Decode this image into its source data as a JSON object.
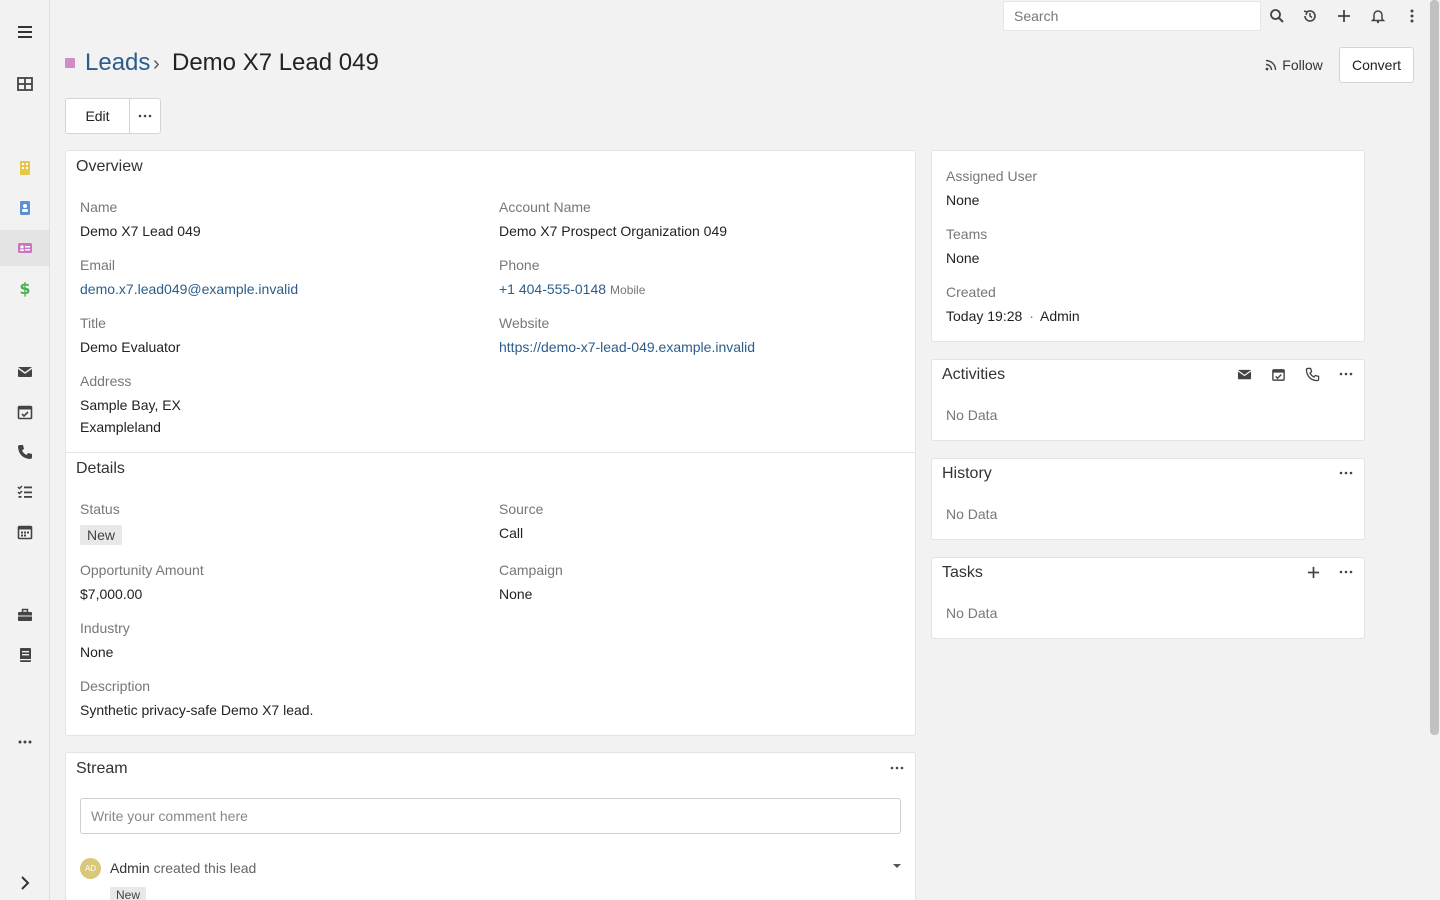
{
  "topbar": {
    "search_placeholder": "Search"
  },
  "header": {
    "scope_link": "Leads",
    "separator": "›",
    "record_name": "Demo X7 Lead 049",
    "follow_label": "Follow",
    "convert_label": "Convert",
    "edit_label": "Edit"
  },
  "overview": {
    "title": "Overview",
    "name_label": "Name",
    "name_value": "Demo X7 Lead 049",
    "account_label": "Account Name",
    "account_value": "Demo X7 Prospect Organization 049",
    "email_label": "Email",
    "email_value": "demo.x7.lead049@example.invalid",
    "phone_label": "Phone",
    "phone_value": "+1 404-555-0148",
    "phone_type": "Mobile",
    "title_label": "Title",
    "title_value": "Demo Evaluator",
    "website_label": "Website",
    "website_value": "https://demo-x7-lead-049.example.invalid",
    "address_label": "Address",
    "address_line1": "Sample Bay, EX",
    "address_line2": "Exampleland"
  },
  "details": {
    "title": "Details",
    "status_label": "Status",
    "status_value": "New",
    "source_label": "Source",
    "source_value": "Call",
    "amount_label": "Opportunity Amount",
    "amount_value": "$7,000.00",
    "campaign_label": "Campaign",
    "campaign_value": "None",
    "industry_label": "Industry",
    "industry_value": "None",
    "description_label": "Description",
    "description_value": "Synthetic privacy-safe Demo X7 lead."
  },
  "side_info": {
    "assigned_label": "Assigned User",
    "assigned_value": "None",
    "teams_label": "Teams",
    "teams_value": "None",
    "created_label": "Created",
    "created_value": "Today 19:28",
    "created_dot": "·",
    "created_by": "Admin"
  },
  "activities": {
    "title": "Activities",
    "empty": "No Data"
  },
  "history": {
    "title": "History",
    "empty": "No Data"
  },
  "tasks": {
    "title": "Tasks",
    "empty": "No Data"
  },
  "stream": {
    "title": "Stream",
    "comment_placeholder": "Write your comment here",
    "entry_avatar": "AD",
    "entry_user": "Admin",
    "entry_text": "created this lead",
    "entry_badge": "New"
  },
  "colors": {
    "link": "#2c5d8a",
    "scope_square": "#d08bc9"
  }
}
